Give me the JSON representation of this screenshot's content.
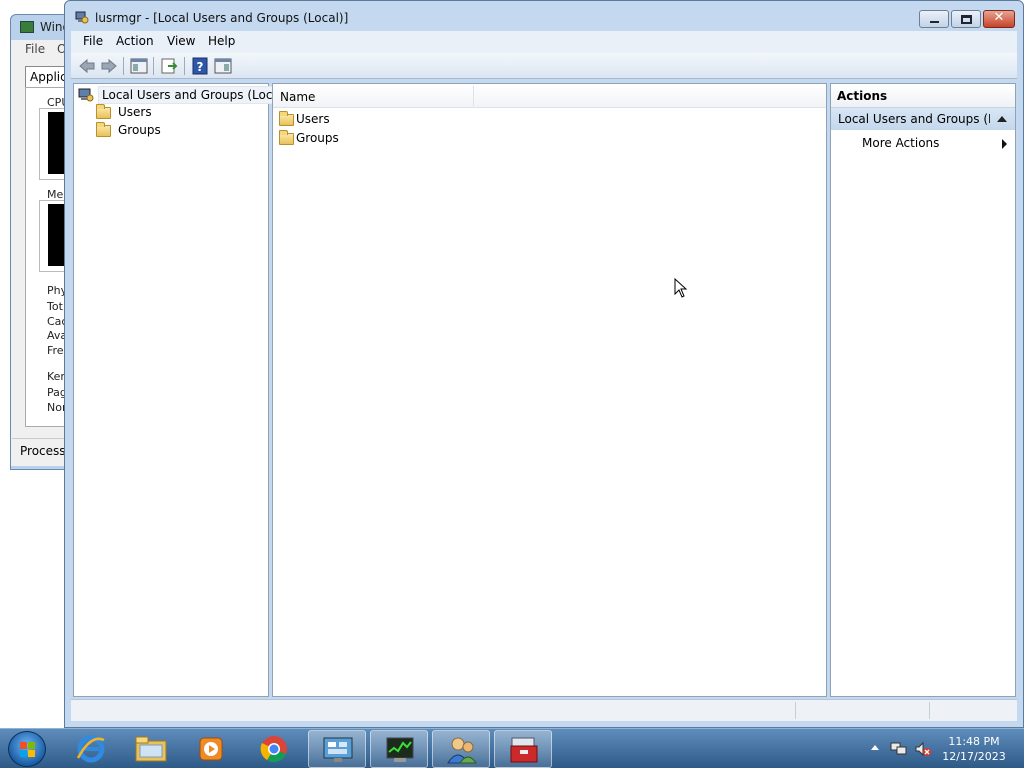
{
  "background_window": {
    "title": "Windows",
    "menu": {
      "file": "File",
      "options": "O"
    },
    "tab": "Applica",
    "labels": {
      "cpu": "CPU",
      "memory": "Mem",
      "physical": "Phy",
      "total": "Tot",
      "cached": "Cac",
      "available": "Ava",
      "free": "Fre",
      "kernel": "Ker",
      "paged": "Pag",
      "nonpaged": "Nor"
    },
    "processes": "Processe"
  },
  "window": {
    "title": "lusrmgr - [Local Users and Groups (Local)]"
  },
  "menu": {
    "file": "File",
    "action": "Action",
    "view": "View",
    "help": "Help"
  },
  "tree": {
    "root": "Local Users and Groups (Local)",
    "items": [
      {
        "label": "Users"
      },
      {
        "label": "Groups"
      }
    ]
  },
  "list": {
    "column_name": "Name",
    "rows": [
      {
        "label": "Users"
      },
      {
        "label": "Groups"
      }
    ]
  },
  "actions": {
    "header": "Actions",
    "section": "Local Users and Groups (Lo...",
    "more": "More Actions"
  },
  "taskbar": {
    "time": "11:48 PM",
    "date": "12/17/2023"
  }
}
